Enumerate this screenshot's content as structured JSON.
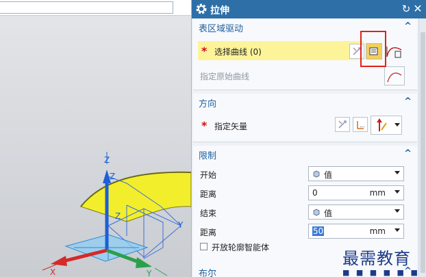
{
  "viewport": {
    "axis_labels": {
      "z_top": "Z",
      "z_mid": "Z",
      "y_right": "Y",
      "x_bottom": "X",
      "y_bottom": "Y",
      "z_near": "Z"
    },
    "colors": {
      "surface": "#f7f12a",
      "x_axis": "#d42a2a",
      "y_axis": "#2aa04a",
      "z_axis": "#1c5fd6",
      "plane": "#4aa8e8"
    }
  },
  "dialog": {
    "title": "拉伸",
    "title_icons": {
      "settings": "gear-icon",
      "reset": "reset-icon",
      "close": "close-icon"
    },
    "sections": {
      "table_region": {
        "title": "表区域驱动",
        "required_marker": "*",
        "select_curve": "选择曲线 (0)",
        "specify_original_curve": "指定原始曲线"
      },
      "direction": {
        "title": "方向",
        "required_marker": "*",
        "specify_vector": "指定矢量"
      },
      "limits": {
        "title": "限制",
        "start_label": "开始",
        "start_value": "值",
        "distance1_label": "距离",
        "distance1_value": "0",
        "distance1_unit": "mm",
        "end_label": "结束",
        "end_value": "值",
        "distance2_label": "距离",
        "distance2_value": "50",
        "distance2_unit": "mm",
        "open_profile_label": "开放轮廓智能体",
        "open_profile_checked": false
      },
      "boolean": {
        "title": "布尔"
      }
    }
  },
  "watermark": {
    "text": "最需教育",
    "sub": "■ ■ ■ ■ ■ ■ ■"
  },
  "highlight_color": "#e0201a"
}
